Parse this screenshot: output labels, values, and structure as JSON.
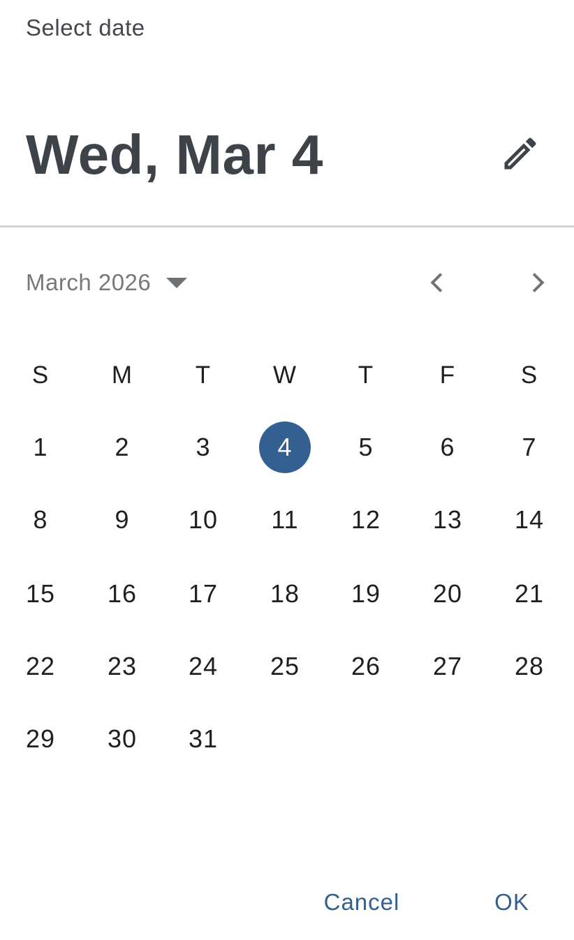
{
  "dialog": {
    "label": "Select date",
    "headline": "Wed, Mar 4",
    "edit_icon": "pencil-icon",
    "month_label": "March 2026",
    "prev_icon": "chevron-left-icon",
    "next_icon": "chevron-right-icon",
    "weekdays": [
      "S",
      "M",
      "T",
      "W",
      "T",
      "F",
      "S"
    ],
    "weeks": [
      [
        "1",
        "2",
        "3",
        "4",
        "5",
        "6",
        "7"
      ],
      [
        "8",
        "9",
        "10",
        "11",
        "12",
        "13",
        "14"
      ],
      [
        "15",
        "16",
        "17",
        "18",
        "19",
        "20",
        "21"
      ],
      [
        "22",
        "23",
        "24",
        "25",
        "26",
        "27",
        "28"
      ],
      [
        "29",
        "30",
        "31"
      ]
    ],
    "selected_day": "4",
    "cancel_label": "Cancel",
    "ok_label": "OK"
  },
  "colors": {
    "accent": "#335f91",
    "headline": "#3d4349",
    "muted": "#76797c",
    "divider": "#d0d2d4"
  }
}
